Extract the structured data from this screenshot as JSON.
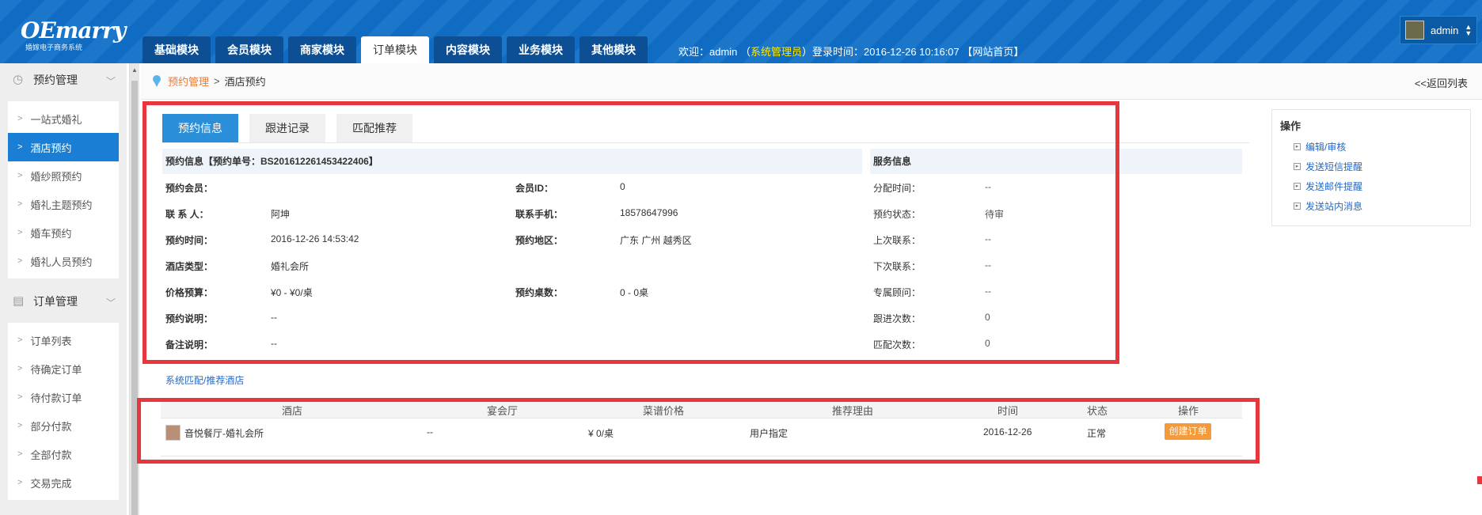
{
  "header": {
    "logo": "OEmarry",
    "logo_sub": "婚嫁电子商务系统",
    "tabs": [
      "基础模块",
      "会员模块",
      "商家模块",
      "订单模块",
      "内容模块",
      "业务模块",
      "其他模块"
    ],
    "active_tab": "订单模块",
    "welcome_prefix": "欢迎：admin （",
    "welcome_role": "系统管理员",
    "welcome_suffix": "）登录时间：2016-12-26 10:16:07 【网站首页】",
    "user": "admin"
  },
  "sidebar": {
    "groups": [
      {
        "title": "预约管理",
        "items": [
          "一站式婚礼",
          "酒店预约",
          "婚纱照预约",
          "婚礼主题预约",
          "婚车预约",
          "婚礼人员预约"
        ],
        "active": "酒店预约"
      },
      {
        "title": "订单管理",
        "items": [
          "订单列表",
          "待确定订单",
          "待付款订单",
          "部分付款",
          "全部付款",
          "交易完成"
        ]
      }
    ]
  },
  "breadcrumb": {
    "root": "预约管理",
    "sep": ">",
    "current": "酒店预约",
    "back": "<<返回列表"
  },
  "tabs": [
    "预约信息",
    "跟进记录",
    "匹配推荐"
  ],
  "booking": {
    "section_title": "预约信息【预约单号：BS201612261453422406】",
    "rows": [
      {
        "l1": "预约会员：",
        "v1": "",
        "l2": "会员ID：",
        "v2": "0"
      },
      {
        "l1": "联 系 人：",
        "v1": "阿坤",
        "l2": "联系手机：",
        "v2": "18578647996"
      },
      {
        "l1": "预约时间：",
        "v1": "2016-12-26 14:53:42",
        "l2": "预约地区：",
        "v2": "广东 广州 越秀区"
      },
      {
        "l1": "酒店类型：",
        "v1": "婚礼会所",
        "l2": "",
        "v2": ""
      },
      {
        "l1": "价格预算：",
        "v1": "¥0 - ¥0/桌",
        "l2": "预约桌数：",
        "v2": "0 - 0桌"
      },
      {
        "l1": "预约说明：",
        "v1": "--",
        "l2": "",
        "v2": ""
      },
      {
        "l1": "备注说明：",
        "v1": "--",
        "l2": "",
        "v2": ""
      }
    ]
  },
  "service": {
    "section_title": "服务信息",
    "rows": [
      {
        "label": "分配时间：",
        "value": "--"
      },
      {
        "label": "预约状态：",
        "value": "待审"
      },
      {
        "label": "上次联系：",
        "value": "--"
      },
      {
        "label": "下次联系：",
        "value": "--"
      },
      {
        "label": "专属顾问：",
        "value": "--"
      },
      {
        "label": "跟进次数：",
        "value": "0"
      },
      {
        "label": "匹配次数：",
        "value": "0"
      }
    ]
  },
  "match_link": "系统匹配/推荐酒店",
  "table": {
    "headers": [
      "酒店",
      "宴会厅",
      "菜谱价格",
      "推荐理由",
      "时间",
      "状态",
      "操作"
    ],
    "row": {
      "hotel": "音悦餐厅-婚礼会所",
      "hall": "--",
      "price": "¥ 0/桌",
      "reason": "用户指定",
      "time": "2016-12-26",
      "status": "正常",
      "action": "创建订单"
    }
  },
  "operations": {
    "title": "操作",
    "links": [
      "编辑/审核",
      "发送短信提醒",
      "发送邮件提醒",
      "发送站内消息"
    ]
  }
}
